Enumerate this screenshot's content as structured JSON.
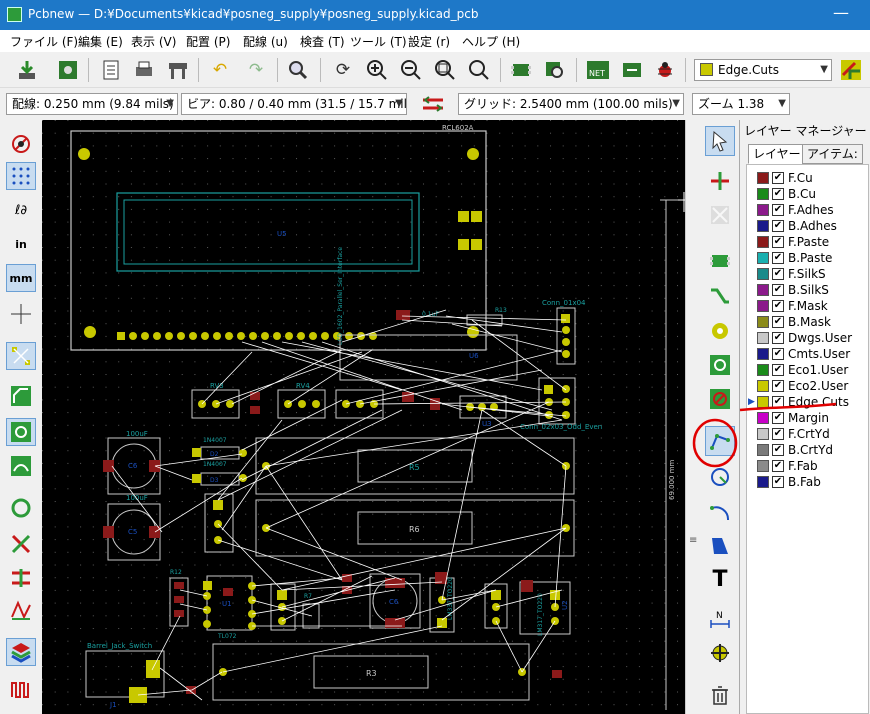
{
  "window": {
    "title": "Pcbnew — D:¥Documents¥kicad¥posneg_supply¥posneg_supply.kicad_pcb",
    "minimize_glyph": "—"
  },
  "menu": [
    "ファイル (F)",
    "編集 (E)",
    "表示 (V)",
    "配置 (P)",
    "配線 (u)",
    "検査 (T)",
    "ツール (T)",
    "設定 (r)",
    "ヘルプ (H)"
  ],
  "toolbar": {
    "active_layer": "Edge.Cuts",
    "active_layer_color": "#c8c800"
  },
  "options_bar": {
    "track_width": "配線: 0.250 mm (9.84 mils) *",
    "via_size": "ビア: 0.80 / 0.40 mm (31.5 / 15.7 mils) *",
    "grid": "グリッド: 2.5400 mm (100.00 mils)",
    "zoom": "ズーム 1.38"
  },
  "layer_manager": {
    "title": "レイヤー マネージャー",
    "tabs": [
      "レイヤー",
      "アイテム:"
    ],
    "layers": [
      {
        "name": "F.Cu",
        "color": "#8b1a1a",
        "checked": true
      },
      {
        "name": "B.Cu",
        "color": "#1a8b1a",
        "checked": true
      },
      {
        "name": "F.Adhes",
        "color": "#8b1a8b",
        "checked": true
      },
      {
        "name": "B.Adhes",
        "color": "#1a1a8b",
        "checked": true
      },
      {
        "name": "F.Paste",
        "color": "#8b1a1a",
        "checked": true
      },
      {
        "name": "B.Paste",
        "color": "#1ab0b0",
        "checked": true
      },
      {
        "name": "F.SilkS",
        "color": "#1a8b8b",
        "checked": true
      },
      {
        "name": "B.SilkS",
        "color": "#8b1a8b",
        "checked": true
      },
      {
        "name": "F.Mask",
        "color": "#8b1a8b",
        "checked": true
      },
      {
        "name": "B.Mask",
        "color": "#8b8b1a",
        "checked": true
      },
      {
        "name": "Dwgs.User",
        "color": "#c8c8c8",
        "checked": true
      },
      {
        "name": "Cmts.User",
        "color": "#1a1a8b",
        "checked": true
      },
      {
        "name": "Eco1.User",
        "color": "#1a8b1a",
        "checked": true
      },
      {
        "name": "Eco2.User",
        "color": "#c8c800",
        "checked": true
      },
      {
        "name": "Edge.Cuts",
        "color": "#c8c800",
        "checked": true,
        "active": true
      },
      {
        "name": "Margin",
        "color": "#c800c8",
        "checked": true
      },
      {
        "name": "F.CrtYd",
        "color": "#c8c8c8",
        "checked": true
      },
      {
        "name": "B.CrtYd",
        "color": "#7a7a7a",
        "checked": true
      },
      {
        "name": "F.Fab",
        "color": "#8b8b8b",
        "checked": true
      },
      {
        "name": "B.Fab",
        "color": "#1a1a8b",
        "checked": true
      }
    ]
  },
  "pcb": {
    "labels": {
      "rcl": "RCL602A",
      "u5_top": "U5",
      "lcd_label": "LCD_1602_Parallel_Ser_Interface",
      "conn1": "Conn_01x04",
      "conn2": "Conn_02x03_Odd_Even",
      "u6": "U6",
      "u3": "U3",
      "rv1": "RV3",
      "rv2": "RV4",
      "r5": "R5",
      "r6": "R6",
      "r3": "R3",
      "c6": "C6",
      "c5": "C5",
      "c100a": "100uF",
      "c100b": "100uF",
      "d2": "D2",
      "d3": "D3",
      "d1n1": "1N4007",
      "d1n2": "1N4007",
      "d1n3": "1N4007",
      "u1": "U1",
      "u2": "U2",
      "lm1": "LM337_TO220",
      "lm2": "LM317_TO220",
      "tl": "TL072",
      "barrel": "Barrel_Jack_Switch",
      "j1": "J1",
      "r12": "R12",
      "r7": "R7",
      "r13": "R13",
      "c01": "0.1uF",
      "dim": "69.000 mm"
    }
  }
}
